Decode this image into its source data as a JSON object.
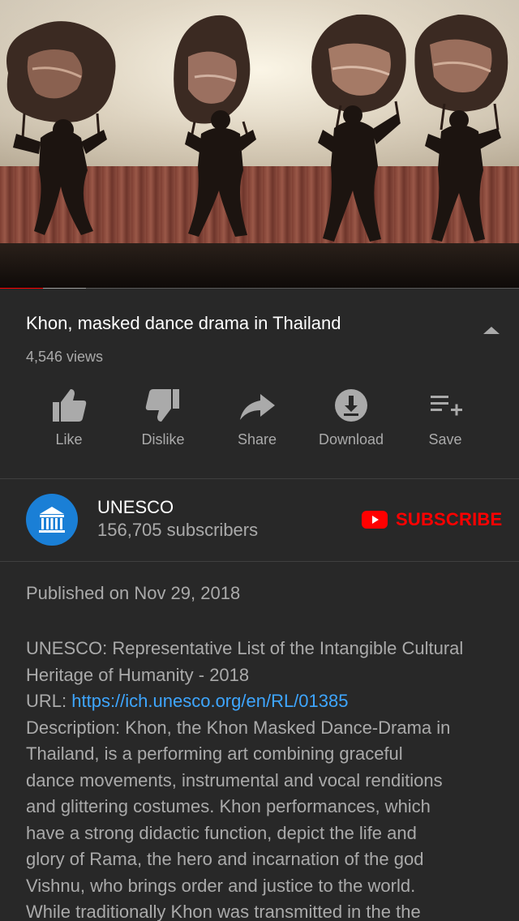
{
  "video": {
    "thumbnail_icon": "shadow-puppet-performance",
    "progress_played": 0.083,
    "progress_buffered": 0.165,
    "progress_color": "#ff0000"
  },
  "title": "Khon, masked dance drama in Thailand",
  "views": "4,546 views",
  "actions": [
    {
      "label": "Like",
      "icon": "thumbs-up-icon"
    },
    {
      "label": "Dislike",
      "icon": "thumbs-down-icon"
    },
    {
      "label": "Share",
      "icon": "share-icon"
    },
    {
      "label": "Download",
      "icon": "download-icon"
    },
    {
      "label": "Save",
      "icon": "playlist-add-icon"
    }
  ],
  "channel": {
    "name": "UNESCO",
    "subscribers": "156,705 subscribers",
    "avatar_color": "#1a7fd6",
    "subscribe_label": "SUBSCRIBE",
    "subscribe_color": "#ff0000"
  },
  "published": "Published on Nov 29, 2018",
  "description": {
    "line1": "UNESCO: Representative List of the Intangible Cultural",
    "line2": "Heritage of Humanity - 2018",
    "url_prefix": "URL: ",
    "url": "https://ich.unesco.org/en/RL/01385",
    "lines": [
      "Description: Khon, the Khon Masked Dance-Drama in",
      "Thailand, is a performing art combining graceful",
      "dance movements, instrumental and vocal renditions",
      "and glittering costumes. Khon performances, which",
      "have a strong didactic function, depict the life and",
      "glory of Rama, the hero and incarnation of the god",
      "Vishnu, who brings order and justice to the world.",
      "While traditionally Khon was transmitted in the the"
    ]
  }
}
